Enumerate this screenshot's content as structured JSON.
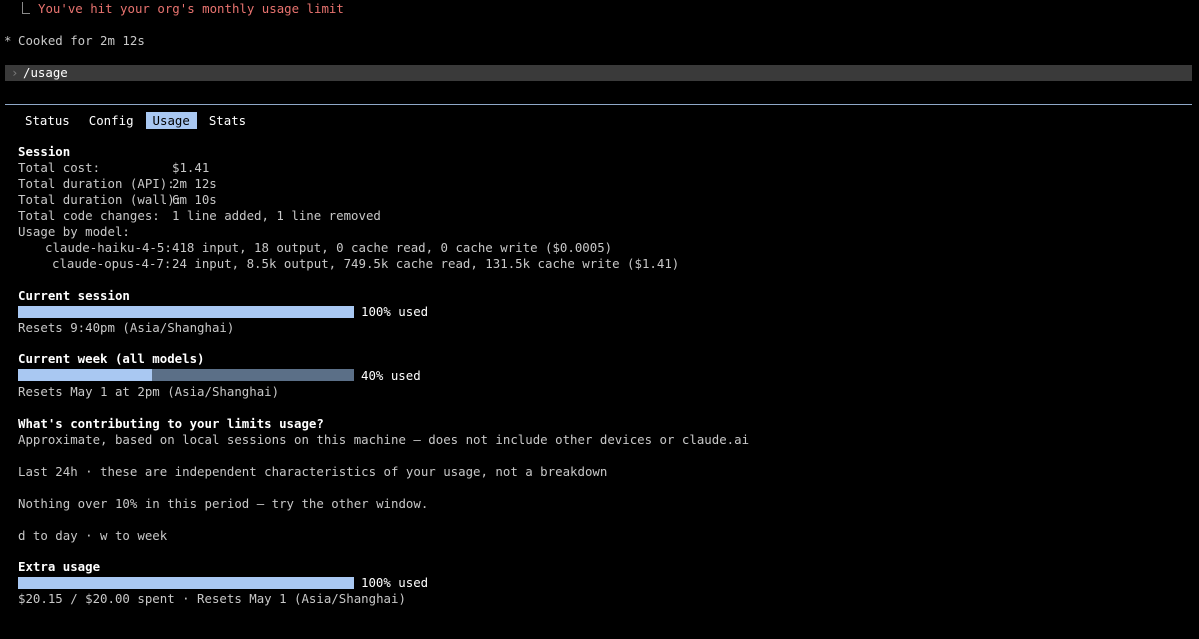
{
  "header": {
    "limit_message": "You've hit your org's monthly usage limit",
    "cooked_star": "*",
    "cooked_text": "Cooked for 2m 12s"
  },
  "prompt": {
    "caret": "›",
    "command": "/usage"
  },
  "tabs": [
    {
      "label": "Status",
      "active": false
    },
    {
      "label": "Config",
      "active": false
    },
    {
      "label": "Usage",
      "active": true
    },
    {
      "label": "Stats",
      "active": false
    }
  ],
  "session": {
    "title": "Session",
    "rows": [
      {
        "label": "Total cost:",
        "value": "$1.41"
      },
      {
        "label": "Total duration (API):",
        "value": "2m 12s"
      },
      {
        "label": "Total duration (wall):",
        "value": "6m 10s"
      },
      {
        "label": "Total code changes:",
        "value": "1 line added, 1 line removed"
      }
    ],
    "usage_by_model_label": "Usage by model:",
    "models": [
      {
        "name": "claude-haiku-4-5:",
        "value": "418 input, 18 output, 0 cache read, 0 cache write ($0.0005)"
      },
      {
        "name": "claude-opus-4-7:",
        "value": "24 input, 8.5k output, 749.5k cache read, 131.5k cache write ($1.41)"
      }
    ]
  },
  "current_session": {
    "title": "Current session",
    "percent_used": 100,
    "used_label": "100% used",
    "resets": "Resets 9:40pm (Asia/Shanghai)"
  },
  "current_week": {
    "title": "Current week (all models)",
    "percent_used": 40,
    "used_label": "40% used",
    "resets": "Resets May 1 at 2pm (Asia/Shanghai)"
  },
  "contributing": {
    "title": "What's contributing to your limits usage?",
    "approx": "Approximate, based on local sessions on this machine — does not include other devices or claude.ai",
    "last24": "Last 24h · these are independent characteristics of your usage, not a breakdown",
    "nothing": "Nothing over 10% in this period — try the other window.",
    "hint": "d to day · w to week"
  },
  "extra_usage": {
    "title": "Extra usage",
    "percent_used": 100,
    "used_label": "100% used",
    "spent": "$20.15 / $20.00 spent · Resets May 1 (Asia/Shanghai)"
  },
  "colors": {
    "background": "#000000",
    "error": "#e8736f",
    "accent": "#a9c8f2",
    "bar_track": "#5b6f87"
  }
}
